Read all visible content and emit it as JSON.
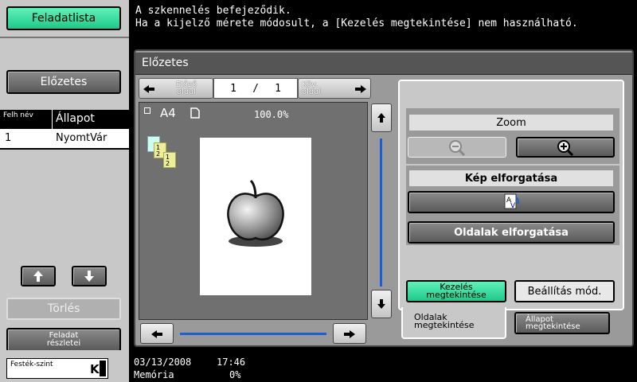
{
  "sidebar": {
    "job_list_label": "Feladatlista",
    "preview_label": "Előzetes",
    "table": {
      "col_user": "Felh név",
      "col_status": "Állapot",
      "rows": [
        {
          "user": "1",
          "status": "NyomtVár"
        }
      ]
    },
    "delete_label": "Törlés",
    "job_details_label": "Feladat részletei",
    "toner_label": "Festék-szint",
    "toner_color": "K"
  },
  "message": {
    "line1": "A szkennelés befejeződik.",
    "line2": "Ha a kijelző mérete módosult, a [Kezelés megtekintése] nem használható."
  },
  "preview": {
    "title": "Előzetes",
    "prev_label": "Előző oldal",
    "next_label": "Köv. oldal",
    "page_current": "1",
    "page_sep": "/",
    "page_total": "1",
    "paper_size": "A4",
    "zoom_level": "100.0%"
  },
  "controls": {
    "zoom_label": "Zoom",
    "rotate_image_label": "Kép elforgatása",
    "rotate_pages_label": "Oldalak elforgatása",
    "check_operation_label": "Kezelés megtekintése",
    "settings_mod_label": "Beállítás mód.",
    "tab_page_view": "Oldalak megtekintése",
    "tab_status_view": "Állapot megtekintése"
  },
  "status": {
    "date": "03/13/2008",
    "time": "17:46",
    "memory_label": "Memória",
    "memory_value": "0%"
  }
}
